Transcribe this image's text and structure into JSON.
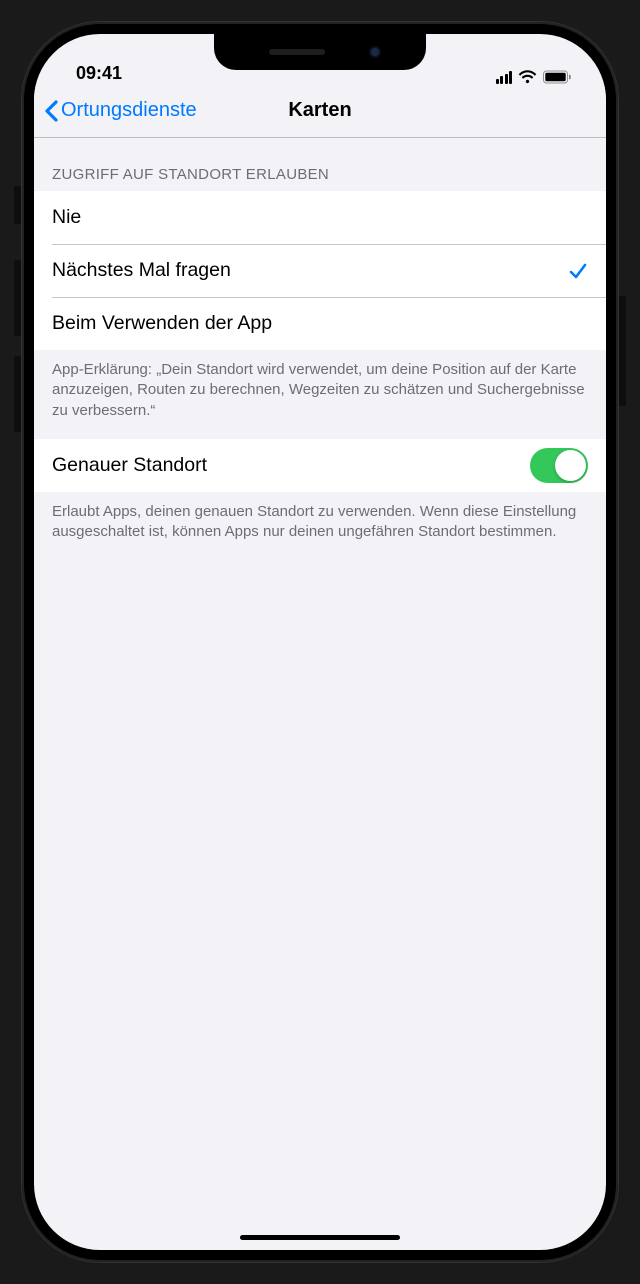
{
  "statusBar": {
    "time": "09:41"
  },
  "nav": {
    "back": "Ortungsdienste",
    "title": "Karten"
  },
  "section1": {
    "header": "ZUGRIFF AUF STANDORT ERLAUBEN",
    "options": {
      "never": "Nie",
      "askNext": "Nächstes Mal fragen",
      "whileUsing": "Beim Verwenden der App"
    },
    "footer": "App-Erklärung: „Dein Standort wird verwendet, um deine Position auf der Karte anzuzeigen, Routen zu berechnen, Wegzeiten zu schätzen und Suchergebnisse zu verbessern.“"
  },
  "section2": {
    "preciseLabel": "Genauer Standort",
    "preciseOn": true,
    "footer": "Erlaubt Apps, deinen genauen Standort zu verwenden. Wenn diese Einstellung ausgeschaltet ist, können Apps nur deinen ungefähren Standort bestimmen."
  }
}
